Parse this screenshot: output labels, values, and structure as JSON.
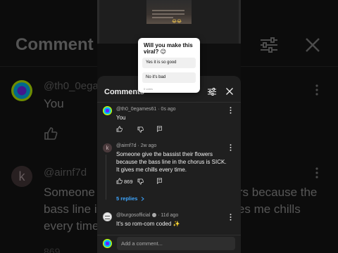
{
  "background": {
    "title": "Comment",
    "comment1": {
      "handle": "@th0_0egames61",
      "text": "You"
    },
    "comment2": {
      "avatar_letter": "k",
      "handle": "@airnf7d",
      "text": "Someone give the bassist their flowers because the bass line in the chorus is SICK. It gives me chills every time."
    },
    "count": "869"
  },
  "video": {
    "caption_emoji": "😂😂"
  },
  "poll": {
    "question": "Will you make this viral? 😉",
    "options": [
      "Yes it is so good",
      "No it's bad"
    ],
    "footer": "0 votes"
  },
  "sheet": {
    "title": "Comments",
    "comments": [
      {
        "handle": "@th0_0egames61",
        "time": "0s ago",
        "text": "You",
        "likes": ""
      },
      {
        "avatar_letter": "k",
        "handle": "@airnf7d",
        "time": "2w ago",
        "text": "Someone give the bassist their flowers because the bass line in the chorus is SICK. It gives me chills every time.",
        "likes": "869"
      },
      {
        "handle": "@burgosofficial",
        "time": "11d ago",
        "text": "It's so rom-com coded ✨"
      }
    ],
    "replies_label": "5 replies",
    "input_placeholder": "Add a comment..."
  },
  "colors": {
    "accent": "#3ea6ff",
    "sheet_bg": "#1f1f1f",
    "page_bg": "#0f0f0f"
  },
  "icons": [
    "filter-icon",
    "close-icon",
    "thumb-up-icon",
    "thumb-down-icon",
    "reply-icon",
    "more-vert-icon",
    "chevron-right-icon",
    "verified-icon"
  ]
}
